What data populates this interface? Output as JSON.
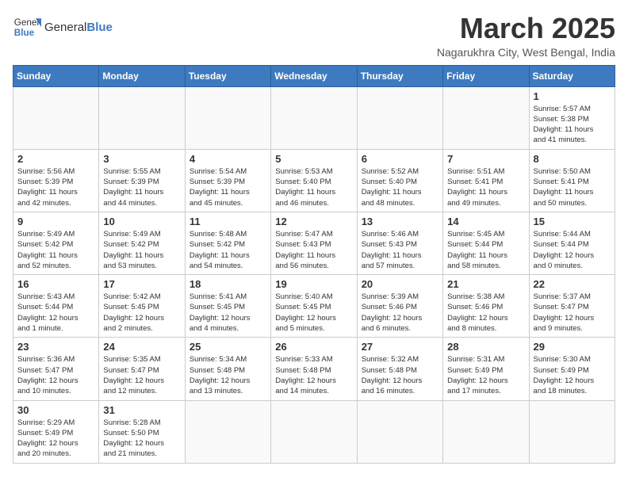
{
  "header": {
    "logo_text_normal": "General",
    "logo_text_bold": "Blue",
    "title": "March 2025",
    "subtitle": "Nagarukhra City, West Bengal, India"
  },
  "weekdays": [
    "Sunday",
    "Monday",
    "Tuesday",
    "Wednesday",
    "Thursday",
    "Friday",
    "Saturday"
  ],
  "weeks": [
    [
      {
        "day": "",
        "info": ""
      },
      {
        "day": "",
        "info": ""
      },
      {
        "day": "",
        "info": ""
      },
      {
        "day": "",
        "info": ""
      },
      {
        "day": "",
        "info": ""
      },
      {
        "day": "",
        "info": ""
      },
      {
        "day": "1",
        "info": "Sunrise: 5:57 AM\nSunset: 5:38 PM\nDaylight: 11 hours\nand 41 minutes."
      }
    ],
    [
      {
        "day": "2",
        "info": "Sunrise: 5:56 AM\nSunset: 5:39 PM\nDaylight: 11 hours\nand 42 minutes."
      },
      {
        "day": "3",
        "info": "Sunrise: 5:55 AM\nSunset: 5:39 PM\nDaylight: 11 hours\nand 44 minutes."
      },
      {
        "day": "4",
        "info": "Sunrise: 5:54 AM\nSunset: 5:39 PM\nDaylight: 11 hours\nand 45 minutes."
      },
      {
        "day": "5",
        "info": "Sunrise: 5:53 AM\nSunset: 5:40 PM\nDaylight: 11 hours\nand 46 minutes."
      },
      {
        "day": "6",
        "info": "Sunrise: 5:52 AM\nSunset: 5:40 PM\nDaylight: 11 hours\nand 48 minutes."
      },
      {
        "day": "7",
        "info": "Sunrise: 5:51 AM\nSunset: 5:41 PM\nDaylight: 11 hours\nand 49 minutes."
      },
      {
        "day": "8",
        "info": "Sunrise: 5:50 AM\nSunset: 5:41 PM\nDaylight: 11 hours\nand 50 minutes."
      }
    ],
    [
      {
        "day": "9",
        "info": "Sunrise: 5:49 AM\nSunset: 5:42 PM\nDaylight: 11 hours\nand 52 minutes."
      },
      {
        "day": "10",
        "info": "Sunrise: 5:49 AM\nSunset: 5:42 PM\nDaylight: 11 hours\nand 53 minutes."
      },
      {
        "day": "11",
        "info": "Sunrise: 5:48 AM\nSunset: 5:42 PM\nDaylight: 11 hours\nand 54 minutes."
      },
      {
        "day": "12",
        "info": "Sunrise: 5:47 AM\nSunset: 5:43 PM\nDaylight: 11 hours\nand 56 minutes."
      },
      {
        "day": "13",
        "info": "Sunrise: 5:46 AM\nSunset: 5:43 PM\nDaylight: 11 hours\nand 57 minutes."
      },
      {
        "day": "14",
        "info": "Sunrise: 5:45 AM\nSunset: 5:44 PM\nDaylight: 11 hours\nand 58 minutes."
      },
      {
        "day": "15",
        "info": "Sunrise: 5:44 AM\nSunset: 5:44 PM\nDaylight: 12 hours\nand 0 minutes."
      }
    ],
    [
      {
        "day": "16",
        "info": "Sunrise: 5:43 AM\nSunset: 5:44 PM\nDaylight: 12 hours\nand 1 minute."
      },
      {
        "day": "17",
        "info": "Sunrise: 5:42 AM\nSunset: 5:45 PM\nDaylight: 12 hours\nand 2 minutes."
      },
      {
        "day": "18",
        "info": "Sunrise: 5:41 AM\nSunset: 5:45 PM\nDaylight: 12 hours\nand 4 minutes."
      },
      {
        "day": "19",
        "info": "Sunrise: 5:40 AM\nSunset: 5:45 PM\nDaylight: 12 hours\nand 5 minutes."
      },
      {
        "day": "20",
        "info": "Sunrise: 5:39 AM\nSunset: 5:46 PM\nDaylight: 12 hours\nand 6 minutes."
      },
      {
        "day": "21",
        "info": "Sunrise: 5:38 AM\nSunset: 5:46 PM\nDaylight: 12 hours\nand 8 minutes."
      },
      {
        "day": "22",
        "info": "Sunrise: 5:37 AM\nSunset: 5:47 PM\nDaylight: 12 hours\nand 9 minutes."
      }
    ],
    [
      {
        "day": "23",
        "info": "Sunrise: 5:36 AM\nSunset: 5:47 PM\nDaylight: 12 hours\nand 10 minutes."
      },
      {
        "day": "24",
        "info": "Sunrise: 5:35 AM\nSunset: 5:47 PM\nDaylight: 12 hours\nand 12 minutes."
      },
      {
        "day": "25",
        "info": "Sunrise: 5:34 AM\nSunset: 5:48 PM\nDaylight: 12 hours\nand 13 minutes."
      },
      {
        "day": "26",
        "info": "Sunrise: 5:33 AM\nSunset: 5:48 PM\nDaylight: 12 hours\nand 14 minutes."
      },
      {
        "day": "27",
        "info": "Sunrise: 5:32 AM\nSunset: 5:48 PM\nDaylight: 12 hours\nand 16 minutes."
      },
      {
        "day": "28",
        "info": "Sunrise: 5:31 AM\nSunset: 5:49 PM\nDaylight: 12 hours\nand 17 minutes."
      },
      {
        "day": "29",
        "info": "Sunrise: 5:30 AM\nSunset: 5:49 PM\nDaylight: 12 hours\nand 18 minutes."
      }
    ],
    [
      {
        "day": "30",
        "info": "Sunrise: 5:29 AM\nSunset: 5:49 PM\nDaylight: 12 hours\nand 20 minutes."
      },
      {
        "day": "31",
        "info": "Sunrise: 5:28 AM\nSunset: 5:50 PM\nDaylight: 12 hours\nand 21 minutes."
      },
      {
        "day": "",
        "info": ""
      },
      {
        "day": "",
        "info": ""
      },
      {
        "day": "",
        "info": ""
      },
      {
        "day": "",
        "info": ""
      },
      {
        "day": "",
        "info": ""
      }
    ]
  ]
}
